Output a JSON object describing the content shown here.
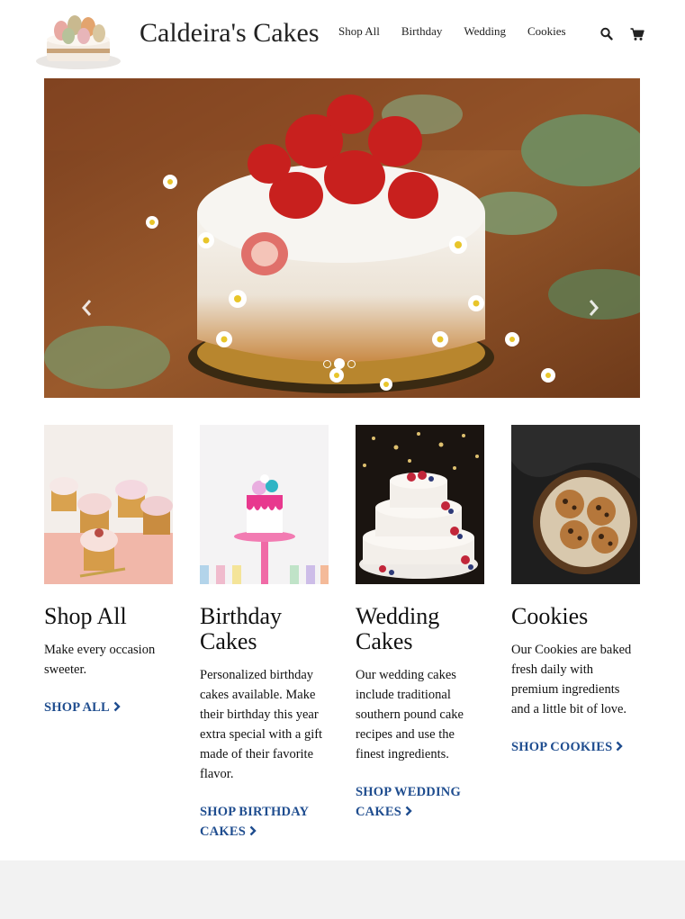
{
  "brand": {
    "name": "Caldeira's Cakes",
    "logo_icon": "cake-logo-icon"
  },
  "nav": {
    "items": [
      {
        "label": "Shop All"
      },
      {
        "label": "Birthday"
      },
      {
        "label": "Wedding"
      },
      {
        "label": "Cookies"
      }
    ],
    "search_icon": "search-icon",
    "cart_icon": "shopping-cart-icon"
  },
  "carousel": {
    "prev_label": "Previous",
    "next_label": "Next",
    "slide_count": 3,
    "active_slide": 2
  },
  "products": [
    {
      "title": "Shop All",
      "description": "Make every occasion sweeter.",
      "link": "SHOP ALL"
    },
    {
      "title": "Birthday Cakes",
      "description": "Personalized birthday cakes available. Make their birthday this year extra special with a gift made of their favorite flavor.",
      "link": "SHOP BIRTHDAY CAKES"
    },
    {
      "title": "Wedding Cakes",
      "description": "Our wedding cakes include traditional southern pound cake recipes and use the finest ingredients.",
      "link": "SHOP WEDDING CAKES"
    },
    {
      "title": "Cookies",
      "description": "Our Cookies are baked fresh daily with premium ingredients and a little bit of love.",
      "link": "SHOP COOKIES"
    }
  ],
  "colors": {
    "link": "#1f4d8f",
    "footer": "#f2f2f2"
  }
}
